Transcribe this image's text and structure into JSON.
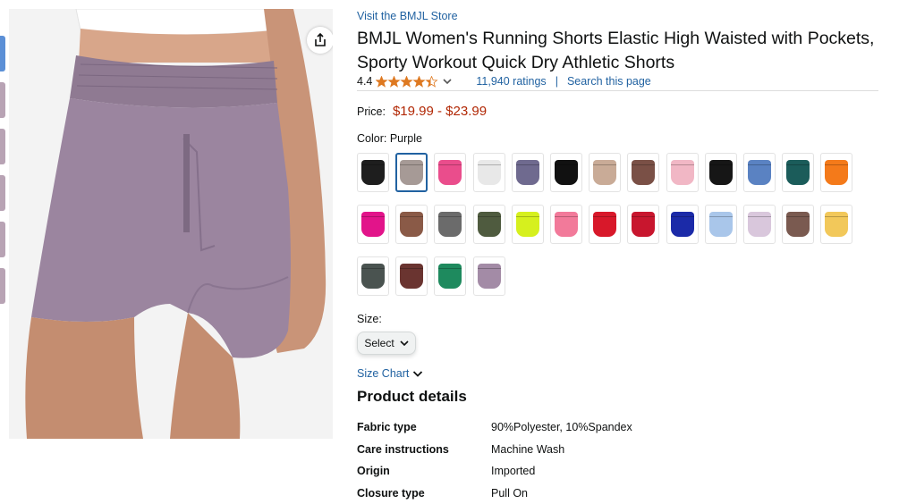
{
  "gallery": {
    "thumb_count": 6,
    "main_image_alt": "Purple high waisted running shorts",
    "share_icon": "share-icon"
  },
  "store_link": "Visit the BMJL Store",
  "title": "BMJL Women's Running Shorts Elastic High Waisted with Pockets, Sporty Workout Quick Dry Athletic Shorts",
  "rating": {
    "value": "4.4",
    "stars": 4.4,
    "count_text": "11,940 ratings",
    "separator": "|",
    "search_link": "Search this page"
  },
  "price": {
    "label": "Price:",
    "value": "$19.99 - $23.99"
  },
  "color": {
    "label": "Color:",
    "selected": "Purple",
    "swatches": [
      "#1e1e1e",
      "#a69a96",
      "#ea4d8c",
      "#e8e8e8",
      "#6f6a8f",
      "#111111",
      "#c9ab97",
      "#7a5046",
      "#f1b7c5",
      "#161616",
      "#5a82c2",
      "#1b5c5a",
      "#f47a1a",
      "#e2148a",
      "#8a5a47",
      "#6b6b6b",
      "#4f5b3f",
      "#d6f01e",
      "#f27a9a",
      "#d8182a",
      "#c8162e",
      "#1b2aa8",
      "#a9c6ea",
      "#d9c7dc",
      "#7a5a50",
      "#f2c85a",
      "#4a5350",
      "#6a3430",
      "#1e8a5e",
      "#a38ba6"
    ],
    "selected_index": 1
  },
  "size": {
    "label": "Size:",
    "select_label": "Select"
  },
  "size_chart": "Size Chart",
  "product_details": {
    "title": "Product details",
    "rows": [
      {
        "k": "Fabric type",
        "v": "90%Polyester, 10%Spandex"
      },
      {
        "k": "Care instructions",
        "v": "Machine Wash"
      },
      {
        "k": "Origin",
        "v": "Imported"
      },
      {
        "k": "Closure type",
        "v": "Pull On"
      }
    ]
  }
}
